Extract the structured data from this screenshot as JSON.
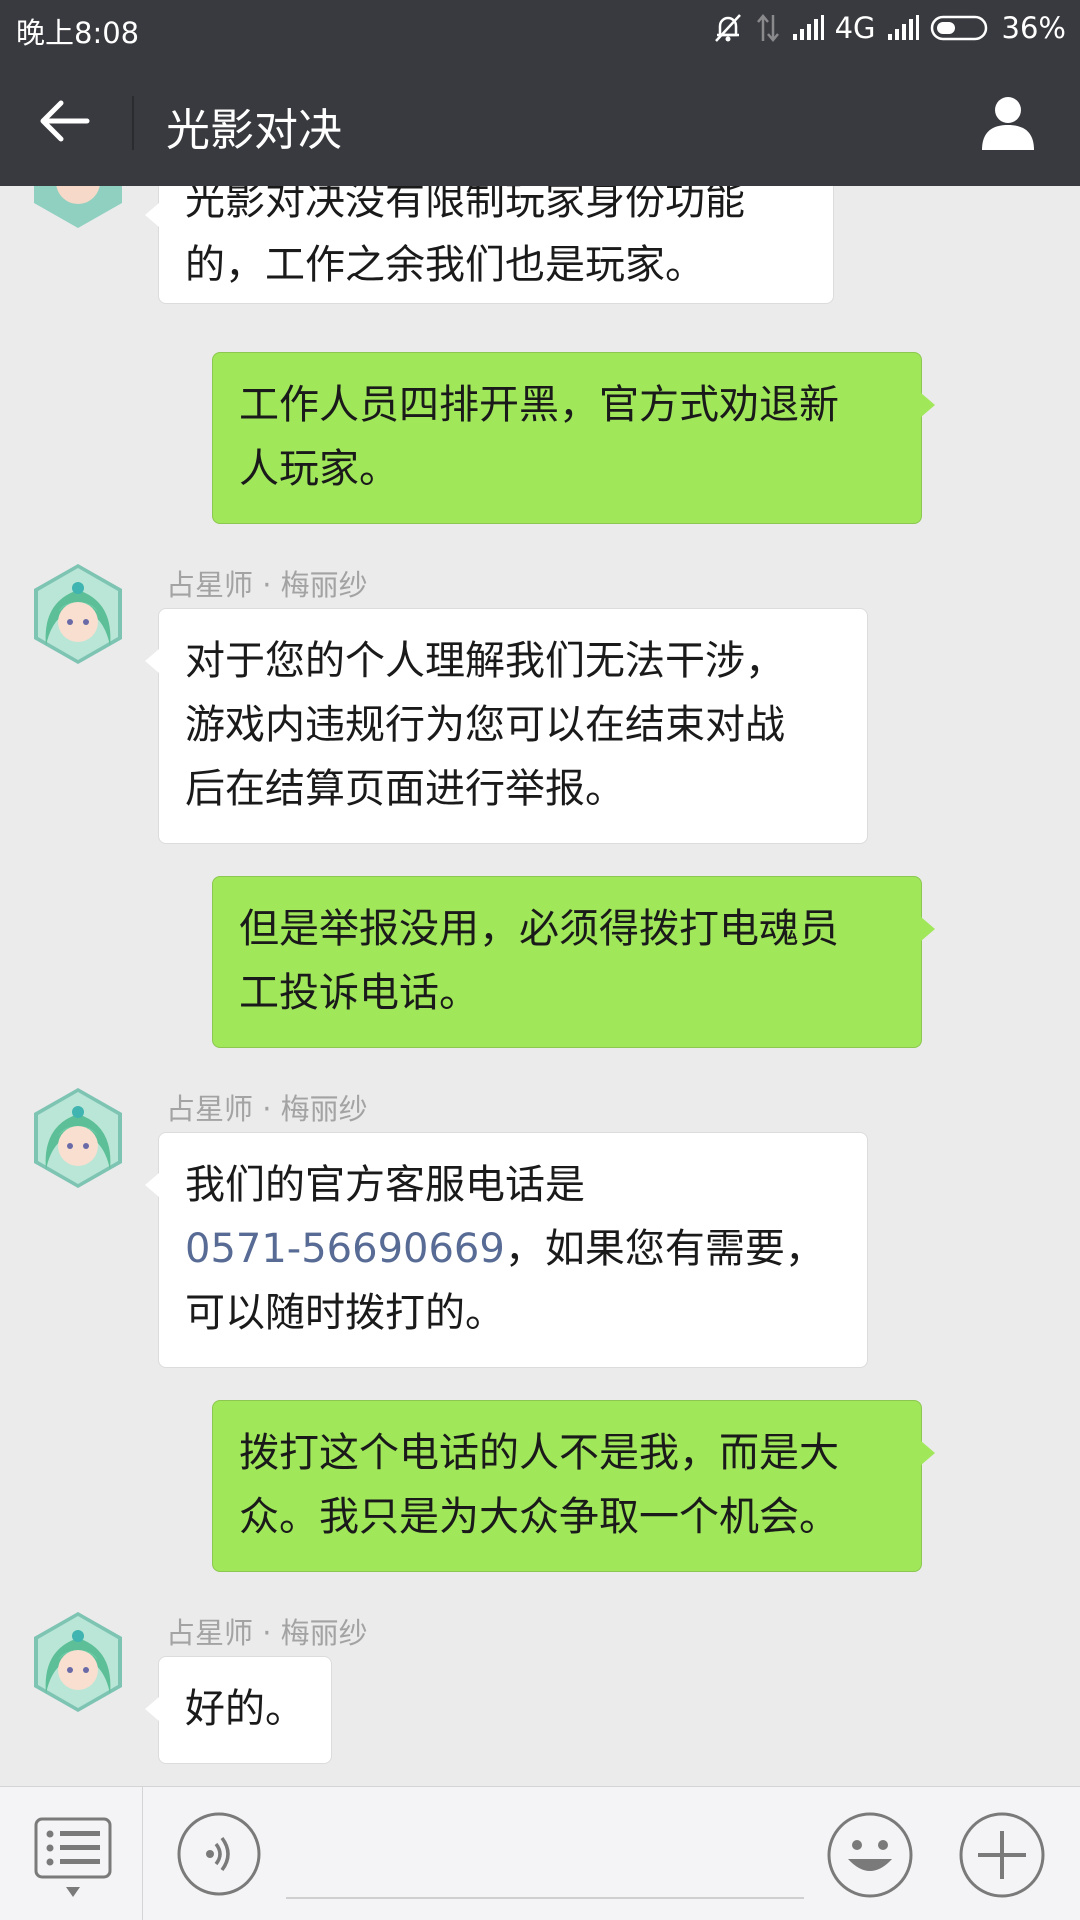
{
  "status_bar": {
    "time": "晚上8:08",
    "network": "4G",
    "battery": "36%",
    "icons": [
      "mute-icon",
      "data-transfer-icon",
      "signal-icon",
      "signal-icon",
      "battery-icon"
    ]
  },
  "header": {
    "title": "光影对决",
    "back_icon": "arrow-left-icon",
    "profile_icon": "person-icon"
  },
  "chat": {
    "messages": [
      {
        "side": "in",
        "lines": [
          "光影对决没有限制玩家身份功能",
          "的，工作之余我们也是玩家。"
        ]
      },
      {
        "side": "out",
        "lines": [
          "工作人员四排开黑，官方式劝退新",
          "人玩家。"
        ]
      },
      {
        "side": "in",
        "sender": "占星师 · 梅丽纱",
        "lines": [
          "对于您的个人理解我们无法干涉，",
          "游戏内违规行为您可以在结束对战",
          "后在结算页面进行举报。"
        ]
      },
      {
        "side": "out",
        "lines": [
          "但是举报没用，必须得拨打电魂员",
          "工投诉电话。"
        ]
      },
      {
        "side": "in",
        "sender": "占星师 · 梅丽纱",
        "lines": [
          "我们的官方客服电话是",
          "，如果您有需要，",
          "可以随时拨打的。"
        ],
        "phone": "0571-56690669"
      },
      {
        "side": "out",
        "lines": [
          "拨打这个电话的人不是我，而是大",
          "众。我只是为大众争取一个机会。"
        ]
      },
      {
        "side": "in",
        "sender": "占星师 · 梅丽纱",
        "lines": [
          "好的。"
        ]
      }
    ]
  },
  "input_bar": {
    "menu_icon": "menu-list-icon",
    "voice_icon": "voice-icon",
    "emoji_icon": "emoji-icon",
    "plus_icon": "plus-icon"
  },
  "colors": {
    "header_bg": "#393a3f",
    "chat_bg": "#ebebeb",
    "outgoing_bubble": "#a0e75a",
    "incoming_bubble": "#ffffff",
    "link": "#576b95"
  }
}
